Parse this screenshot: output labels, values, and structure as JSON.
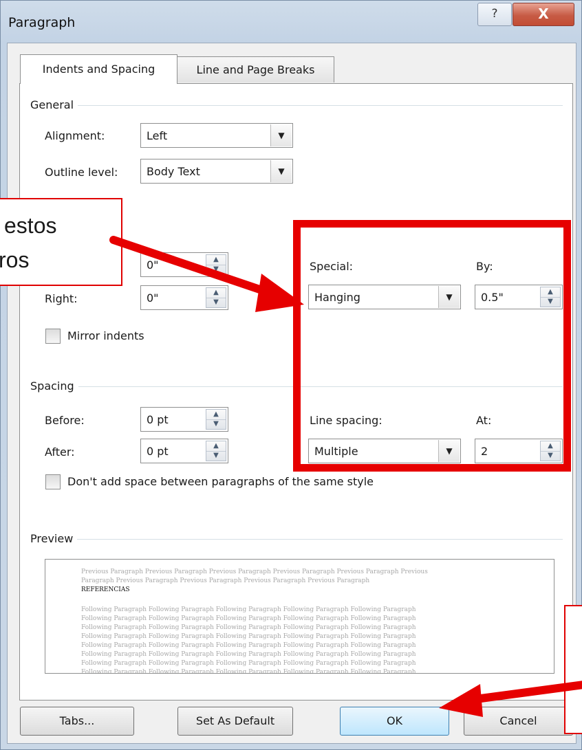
{
  "window": {
    "title": "Paragraph",
    "help_glyph": "?",
    "close_glyph": "X"
  },
  "tabs": [
    {
      "label": "Indents and Spacing",
      "active": true
    },
    {
      "label": "Line and Page Breaks",
      "active": false
    }
  ],
  "general": {
    "heading": "General",
    "alignment_label": "Alignment:",
    "alignment_value": "Left",
    "outline_label": "Outline level:",
    "outline_value": "Body Text"
  },
  "indentation": {
    "left_value": "0\"",
    "right_label": "Right:",
    "right_value": "0\"",
    "special_label": "Special:",
    "special_value": "Hanging",
    "by_label": "By:",
    "by_value": "0.5\"",
    "mirror_label": "Mirror indents"
  },
  "spacing": {
    "heading": "Spacing",
    "before_label": "Before:",
    "before_value": "0 pt",
    "after_label": "After:",
    "after_value": "0 pt",
    "line_spacing_label": "Line spacing:",
    "line_spacing_value": "Multiple",
    "at_label": "At:",
    "at_value": "2",
    "dont_add_label": "Don't add space between paragraphs of the same style"
  },
  "preview": {
    "heading": "Preview",
    "previous_line_1": "Previous Paragraph Previous Paragraph Previous Paragraph Previous Paragraph Previous Paragraph Previous",
    "previous_line_2": "Paragraph Previous Paragraph Previous Paragraph Previous Paragraph Previous Paragraph",
    "main_text": "REFERENCIAS",
    "following_line": "Following Paragraph Following Paragraph Following Paragraph Following Paragraph Following Paragraph"
  },
  "buttons": {
    "tabs": "Tabs...",
    "set_default": "Set As Default",
    "ok": "OK",
    "cancel": "Cancel"
  },
  "annotations": {
    "callout_line_1": "estos",
    "callout_line_2": "ros",
    "highlight_color": "#e60000"
  }
}
